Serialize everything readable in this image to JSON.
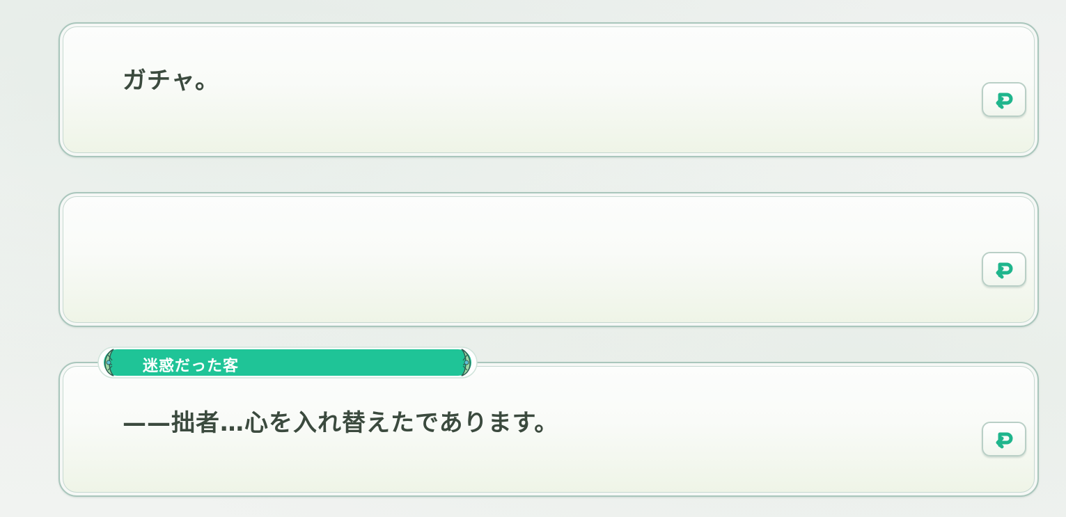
{
  "log": {
    "entries": [
      {
        "speaker": "",
        "text": "ガチャ。"
      },
      {
        "speaker": "",
        "text": ""
      },
      {
        "speaker": "迷惑だった客",
        "text": "——拙者…心を入れ替えたであります。"
      }
    ]
  },
  "icons": {
    "replay": "replay-arrow-icon"
  },
  "colors": {
    "accent": "#1fc497",
    "text": "#3b4a3e",
    "panel_border": "#a9c6bc"
  }
}
